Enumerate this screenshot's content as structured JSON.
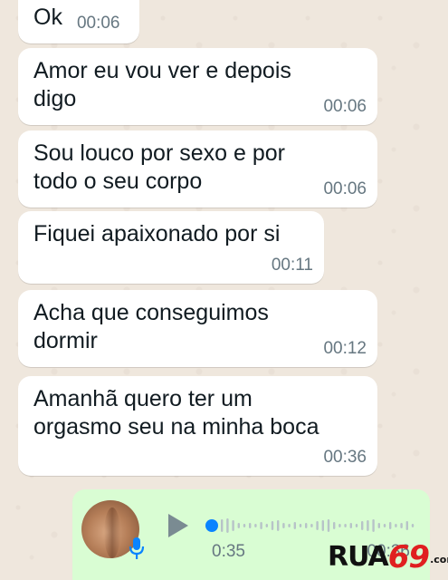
{
  "messages": [
    {
      "text": "Ok",
      "time": "00:06"
    },
    {
      "text": "Amor eu vou ver e depois\ndigo",
      "time": "00:06"
    },
    {
      "text": "Sou louco por sexo e por\ntodo o seu corpo",
      "time": "00:06"
    },
    {
      "text": "Fiquei apaixonado por si",
      "time": "00:11"
    },
    {
      "text": "Acha que conseguimos\ndormir",
      "time": "00:12"
    },
    {
      "text": "Amanhã quero ter um\norgasmo seu na minha boca",
      "time": "00:36"
    }
  ],
  "voice_note": {
    "duration": "0:35",
    "time": "00:36",
    "playback_progress": 0.0,
    "bubble_color": "#d9fdd3",
    "icons": [
      "play-icon",
      "microphone-icon"
    ],
    "accent_color": "#0a84ff"
  },
  "watermark": {
    "brand": "RUA",
    "number": "69",
    "domain": ".com"
  },
  "colors": {
    "wallpaper": "#efe7dd",
    "incoming_bubble": "#ffffff",
    "text": "#111b21",
    "timestamp": "#667781"
  }
}
